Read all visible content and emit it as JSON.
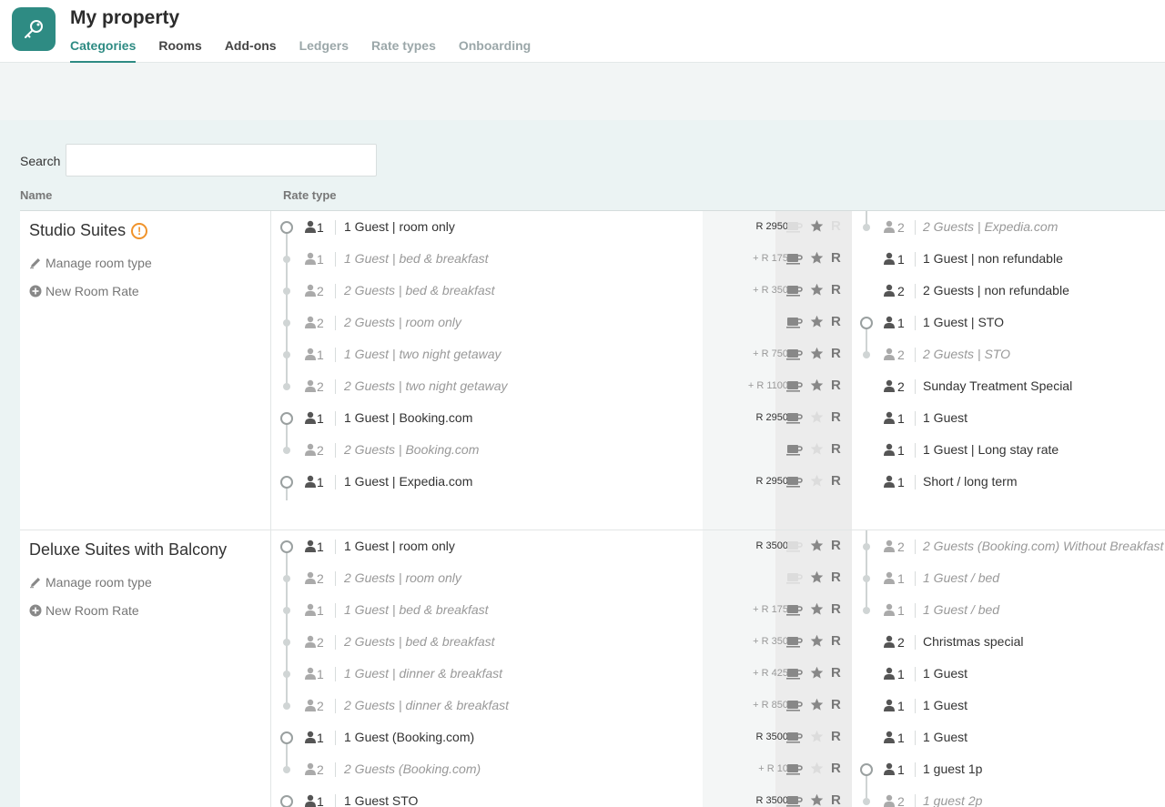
{
  "header": {
    "title": "My property",
    "tabs": [
      {
        "label": "Categories",
        "state": "active"
      },
      {
        "label": "Rooms",
        "state": "normal"
      },
      {
        "label": "Add-ons",
        "state": "normal"
      },
      {
        "label": "Ledgers",
        "state": "muted"
      },
      {
        "label": "Rate types",
        "state": "muted"
      },
      {
        "label": "Onboarding",
        "state": "muted"
      }
    ]
  },
  "search": {
    "label": "Search",
    "value": "",
    "placeholder": ""
  },
  "columns": {
    "name": "Name",
    "rate_type": "Rate type"
  },
  "colors": {
    "accent": "#2e8b83",
    "warning": "#f0932b"
  },
  "categories": [
    {
      "name": "Studio Suites",
      "warning": "!",
      "manage_label": "Manage room type",
      "new_rate_label": "New Room Rate",
      "rates": [
        {
          "occ": "1",
          "name": "1 Guest | room only",
          "price": "R 2950",
          "derived": false,
          "breakfast": "off",
          "star": "on",
          "r": "faint"
        },
        {
          "occ": "1",
          "name": "1 Guest | bed & breakfast",
          "price": "+ R 175",
          "derived": true,
          "breakfast": "on",
          "star": "on",
          "r": "on"
        },
        {
          "occ": "2",
          "name": "2 Guests | bed & breakfast",
          "price": "+ R 350",
          "derived": true,
          "breakfast": "on",
          "star": "on",
          "r": "on"
        },
        {
          "occ": "2",
          "name": "2 Guests | room only",
          "price": "",
          "derived": true,
          "breakfast": "on",
          "star": "on",
          "r": "on"
        },
        {
          "occ": "1",
          "name": "1 Guest | two night getaway",
          "price": "+ R 750",
          "derived": true,
          "breakfast": "on",
          "star": "on",
          "r": "on"
        },
        {
          "occ": "2",
          "name": "2 Guests | two night getaway",
          "price": "+ R 1100",
          "derived": true,
          "breakfast": "on",
          "star": "on",
          "r": "on"
        },
        {
          "occ": "1",
          "name": "1 Guest | Booking.com",
          "price": "R 2950",
          "derived": false,
          "breakfast": "on",
          "star": "off",
          "r": "on"
        },
        {
          "occ": "2",
          "name": "2 Guests | Booking.com",
          "price": "",
          "derived": true,
          "breakfast": "on",
          "star": "off",
          "r": "on"
        },
        {
          "occ": "1",
          "name": "1 Guest | Expedia.com",
          "price": "R 2950",
          "derived": false,
          "breakfast": "on",
          "star": "off",
          "r": "on"
        }
      ],
      "rates_right": [
        {
          "occ": "2",
          "name": "2 Guests | Expedia.com",
          "derived": true
        },
        {
          "occ": "1",
          "name": "1 Guest | non refundable",
          "derived": false
        },
        {
          "occ": "2",
          "name": "2 Guests | non refundable",
          "derived": false
        },
        {
          "occ": "1",
          "name": "1 Guest | STO",
          "derived": false
        },
        {
          "occ": "2",
          "name": "2 Guests | STO",
          "derived": true
        },
        {
          "occ": "2",
          "name": "Sunday Treatment Special",
          "derived": false
        },
        {
          "occ": "1",
          "name": "1 Guest",
          "derived": false
        },
        {
          "occ": "1",
          "name": "1 Guest | Long stay rate",
          "derived": false
        },
        {
          "occ": "1",
          "name": "Short / long term",
          "derived": false
        }
      ]
    },
    {
      "name": "Deluxe Suites with Balcony",
      "warning": "",
      "manage_label": "Manage room type",
      "new_rate_label": "New Room Rate",
      "rates": [
        {
          "occ": "1",
          "name": "1 Guest | room only",
          "price": "R 3500",
          "derived": false,
          "breakfast": "off",
          "star": "on",
          "r": "on"
        },
        {
          "occ": "2",
          "name": "2 Guests | room only",
          "price": "",
          "derived": true,
          "breakfast": "off",
          "star": "on",
          "r": "on"
        },
        {
          "occ": "1",
          "name": "1 Guest | bed & breakfast",
          "price": "+ R 175",
          "derived": true,
          "breakfast": "on",
          "star": "on",
          "r": "on"
        },
        {
          "occ": "2",
          "name": "2 Guests | bed & breakfast",
          "price": "+ R 350",
          "derived": true,
          "breakfast": "on",
          "star": "on",
          "r": "on"
        },
        {
          "occ": "1",
          "name": "1 Guest | dinner & breakfast",
          "price": "+ R 425",
          "derived": true,
          "breakfast": "on",
          "star": "on",
          "r": "on"
        },
        {
          "occ": "2",
          "name": "2 Guests | dinner & breakfast",
          "price": "+ R 850",
          "derived": true,
          "breakfast": "on",
          "star": "on",
          "r": "on"
        },
        {
          "occ": "1",
          "name": "1 Guest (Booking.com)",
          "price": "R 3500",
          "derived": false,
          "breakfast": "on",
          "star": "off",
          "r": "on"
        },
        {
          "occ": "2",
          "name": "2 Guests (Booking.com)",
          "price": "+ R 10",
          "derived": true,
          "breakfast": "on",
          "star": "off",
          "r": "on"
        },
        {
          "occ": "1",
          "name": "1 Guest STO",
          "price": "R 3500",
          "derived": false,
          "breakfast": "on",
          "star": "on",
          "r": "on"
        }
      ],
      "rates_right": [
        {
          "occ": "2",
          "name": "2 Guests (Booking.com) Without Breakfast",
          "derived": true
        },
        {
          "occ": "1",
          "name": "1 Guest / bed",
          "derived": true
        },
        {
          "occ": "1",
          "name": "1 Guest / bed",
          "derived": true
        },
        {
          "occ": "2",
          "name": "Christmas special",
          "derived": false
        },
        {
          "occ": "1",
          "name": "1 Guest",
          "derived": false
        },
        {
          "occ": "1",
          "name": "1 Guest",
          "derived": false
        },
        {
          "occ": "1",
          "name": "1 Guest",
          "derived": false
        },
        {
          "occ": "1",
          "name": "1 guest 1p",
          "derived": false
        },
        {
          "occ": "2",
          "name": "1 guest 2p",
          "derived": true
        }
      ]
    }
  ]
}
